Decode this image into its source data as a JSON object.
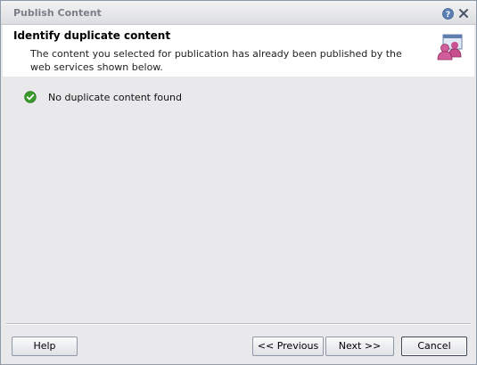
{
  "window": {
    "title": "Publish Content",
    "icons": {
      "help": "help-icon",
      "close": "close-icon"
    }
  },
  "header": {
    "title": "Identify duplicate content",
    "description": "The content you selected for publication has already been published by the web services shown below.",
    "icon": "users-publish-icon"
  },
  "status": {
    "icon": "check-circle-icon",
    "text": "No duplicate content found",
    "color": "#3a9a2c"
  },
  "footer": {
    "help_label": "Help",
    "previous_label": "<< Previous",
    "next_label": "Next >>",
    "cancel_label": "Cancel"
  }
}
